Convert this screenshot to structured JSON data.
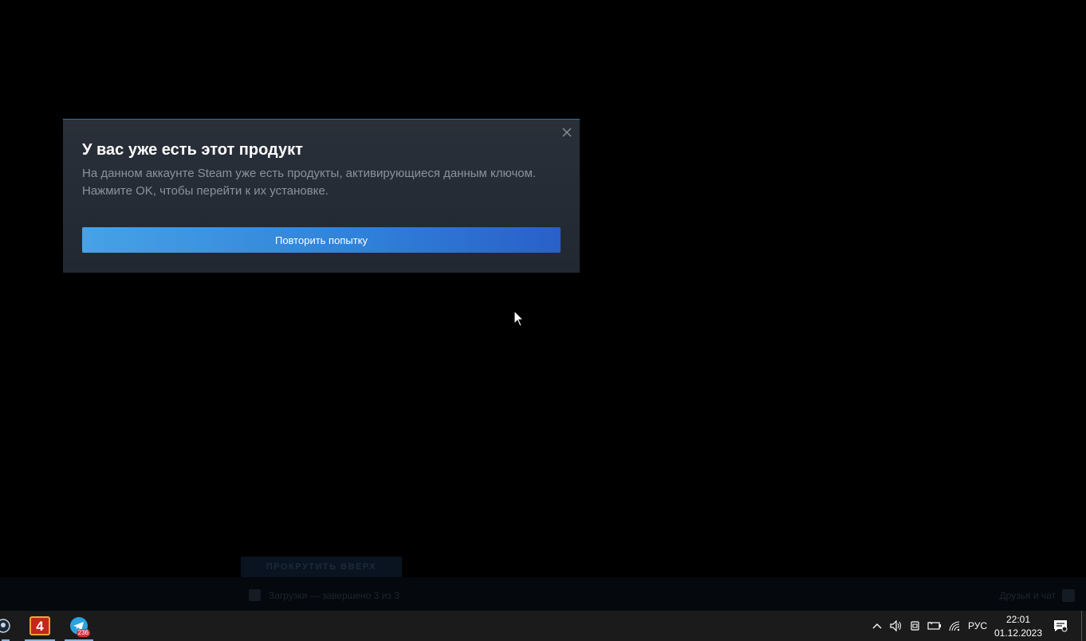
{
  "dialog": {
    "title": "У вас уже есть этот продукт",
    "message": "На данном аккаунте Steam уже есть продукты, активирующиеся данным ключом. Нажмите OK, чтобы перейти к их установке.",
    "retry_label": "Повторить попытку",
    "close_icon": "close-icon"
  },
  "steam_background": {
    "scroll_top_label": "ПРОКРУТИТЬ ВВЕРХ",
    "downloads_label": "Загрузки — завершено 3 из 3",
    "friends_label": "Друзья и чат"
  },
  "taskbar": {
    "apps": [
      {
        "name": "steam-icon"
      },
      {
        "name": "app-4-icon",
        "label": "4"
      },
      {
        "name": "telegram-icon",
        "badge": "236"
      }
    ],
    "tray": {
      "language": "РУС",
      "time": "22:01",
      "date": "01.12.2023"
    }
  },
  "colors": {
    "dialog_accent": "#3d6f9e",
    "button_start": "#47a2e6",
    "button_end": "#2a5fc9"
  }
}
